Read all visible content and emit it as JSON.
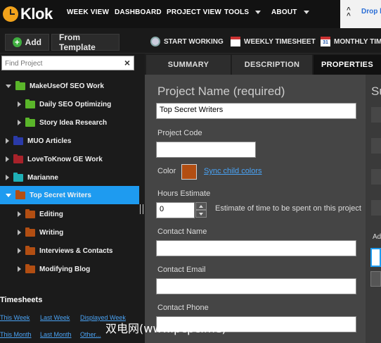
{
  "app": {
    "name": "Klok"
  },
  "nav": {
    "week_view": "WEEK VIEW",
    "dashboard": "DASHBOARD",
    "project_view": "PROJECT VIEW",
    "tools": "TOOLS",
    "about": "ABOUT",
    "dropbox": "Drop b"
  },
  "toolbar": {
    "add": "Add",
    "from_template": "From Template",
    "start_working": "START WORKING",
    "weekly_timesheet": "WEEKLY TIMESHEET",
    "monthly_timesheet": "MONTHLY TIME",
    "calendar_number": "31"
  },
  "sidebar": {
    "search_placeholder": "Find Project",
    "items": [
      {
        "label": "MakeUseOf SEO Work",
        "color": "#5ab52a"
      },
      {
        "label": "Daily SEO Optimizing",
        "color": "#5ab52a"
      },
      {
        "label": "Story Idea Research",
        "color": "#5ab52a"
      },
      {
        "label": "MUO Articles",
        "color": "#2a3aa8"
      },
      {
        "label": "LoveToKnow GE Work",
        "color": "#a8222a"
      },
      {
        "label": "Marianne",
        "color": "#1fb0b6"
      },
      {
        "label": "Top Secret Writers",
        "color": "#b24e12"
      },
      {
        "label": "Editing",
        "color": "#b24e12"
      },
      {
        "label": "Writing",
        "color": "#b24e12"
      },
      {
        "label": "Interviews & Contacts",
        "color": "#b24e12"
      },
      {
        "label": "Modifying Blog",
        "color": "#b24e12"
      }
    ],
    "selected": "Top Secret Writers"
  },
  "timesheets": {
    "title": "Timesheets",
    "links": [
      "This Week",
      "Last Week",
      "Displayed Week",
      "This Month",
      "Last Month",
      "Other..."
    ]
  },
  "tabs": [
    "SUMMARY",
    "DESCRIPTION",
    "PROPERTIES"
  ],
  "active_tab": "PROPERTIES",
  "form": {
    "project_name_label": "Project Name (required)",
    "project_name_value": "Top Secret Writers",
    "project_code_label": "Project Code",
    "project_code_value": "",
    "color_label": "Color",
    "color_value": "#b24e12",
    "sync_child_colors": "Sync child colors",
    "hours_estimate_label": "Hours Estimate",
    "hours_estimate_value": "0",
    "hours_estimate_hint": "Estimate of time to be spent on this project",
    "contact_name_label": "Contact Name",
    "contact_name_value": "",
    "contact_email_label": "Contact Email",
    "contact_email_value": "",
    "contact_phone_label": "Contact Phone",
    "contact_phone_value": ""
  },
  "right_panel": {
    "title": "Su",
    "label": "Ad"
  },
  "watermark": "双电网(www.pcpc.me)"
}
